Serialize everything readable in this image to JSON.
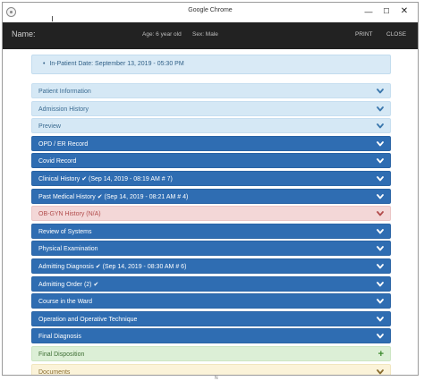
{
  "window": {
    "title": "Google Chrome",
    "controls": {
      "minimize": "—",
      "maximize": "☐",
      "close": "✕"
    }
  },
  "header": {
    "name_label": "Name:",
    "age": "Age: 6 year old",
    "sex": "Sex: Male",
    "print": "PRINT",
    "close": "CLOSE"
  },
  "inpatient": {
    "bullet": "•",
    "text": "In-Patient Date: September 13, 2019 - 05:30 PM"
  },
  "panels": [
    {
      "label": "Patient Information",
      "style": "info",
      "icon": "chevron-down"
    },
    {
      "label": "Admission History",
      "style": "info",
      "icon": "chevron-down"
    },
    {
      "label": "Preview",
      "style": "info",
      "icon": "chevron-down"
    },
    {
      "label": "OPD / ER Record",
      "style": "primary",
      "icon": "chevron-down"
    },
    {
      "label": "Covid Record",
      "style": "primary",
      "icon": "chevron-down"
    },
    {
      "label": "Clinical History ✔ (Sep 14, 2019 - 08:19 AM # 7)",
      "style": "primary",
      "icon": "chevron-down"
    },
    {
      "label": "Past Medical History ✔ (Sep 14, 2019 - 08:21 AM # 4)",
      "style": "primary",
      "icon": "chevron-down"
    },
    {
      "label": "OB-GYN History (N/A)",
      "style": "danger",
      "icon": "chevron-down"
    },
    {
      "label": "Review of Systems",
      "style": "primary",
      "icon": "chevron-down"
    },
    {
      "label": "Physical Examination",
      "style": "primary",
      "icon": "chevron-down"
    },
    {
      "label": "Admitting Diagnosis ✔ (Sep 14, 2019 - 08:30 AM # 6)",
      "style": "primary",
      "icon": "chevron-down"
    },
    {
      "label": "Admitting Order (2) ✔",
      "style": "primary",
      "icon": "chevron-down"
    },
    {
      "label": "Course in the Ward",
      "style": "primary",
      "icon": "chevron-down"
    },
    {
      "label": "Operation and Operative Technique",
      "style": "primary",
      "icon": "chevron-down"
    },
    {
      "label": "Final Diagnosis",
      "style": "primary",
      "icon": "chevron-down"
    },
    {
      "label": "Final Disposition",
      "style": "success",
      "icon": "plus"
    },
    {
      "label": "Documents",
      "style": "warning",
      "icon": "chevron-down"
    }
  ],
  "footer_marker": "N",
  "colors": {
    "appbar": "#222222",
    "primary": "#2f6db2",
    "info": "#d5e8f5",
    "danger": "#f3d7d7",
    "success": "#dcefd6",
    "warning": "#fbf3d9"
  }
}
